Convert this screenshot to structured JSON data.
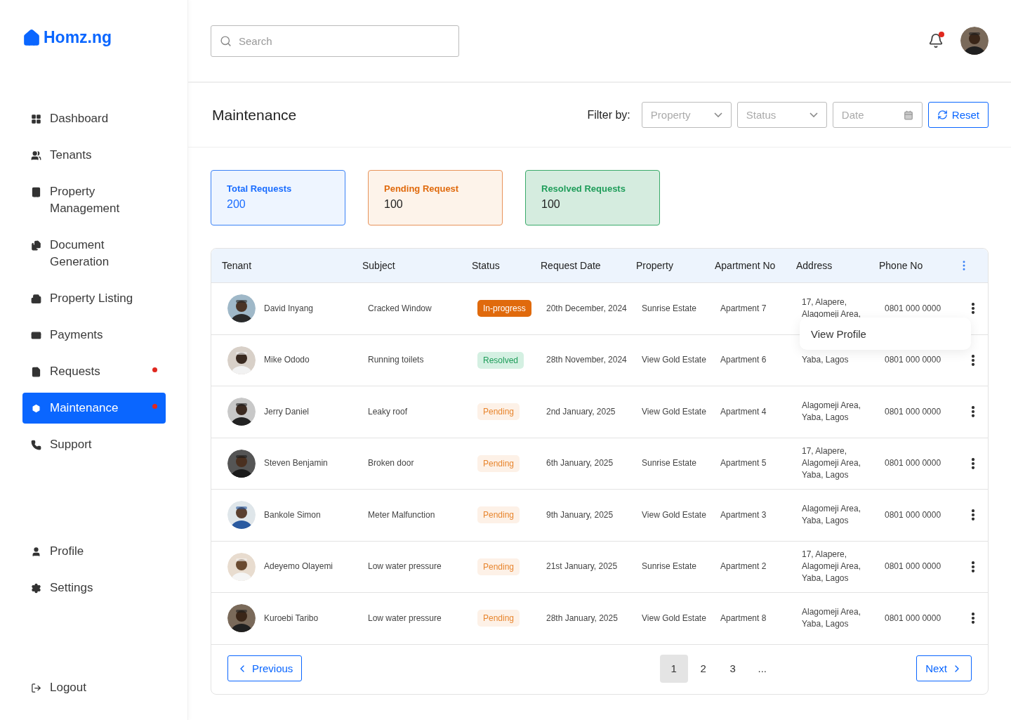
{
  "brand": {
    "name": "Homz.ng"
  },
  "sidebar": {
    "items": [
      {
        "label": "Dashboard",
        "selected": false,
        "dot": false
      },
      {
        "label": "Tenants",
        "selected": false,
        "dot": false
      },
      {
        "label": "Property Management",
        "selected": false,
        "dot": false
      },
      {
        "label": "Document Generation",
        "selected": false,
        "dot": false
      },
      {
        "label": "Property Listing",
        "selected": false,
        "dot": false
      },
      {
        "label": "Payments",
        "selected": false,
        "dot": false
      },
      {
        "label": "Requests",
        "selected": false,
        "dot": true
      },
      {
        "label": "Maintenance",
        "selected": true,
        "dot": true
      },
      {
        "label": "Support",
        "selected": false,
        "dot": false
      }
    ],
    "bottom_items": [
      {
        "label": "Profile"
      },
      {
        "label": "Settings"
      }
    ],
    "logout": "Logout"
  },
  "topbar": {
    "search": {
      "placeholder": "Search"
    },
    "notification_dot": true
  },
  "page": {
    "title": "Maintenance",
    "filter_label": "Filter by:",
    "filters": [
      {
        "kind": "select",
        "placeholder": "Property"
      },
      {
        "kind": "select",
        "placeholder": "Status"
      },
      {
        "kind": "date",
        "placeholder": "Date"
      }
    ],
    "reset": "Reset"
  },
  "cards": [
    {
      "kind": "total",
      "label": "Total Requests",
      "value": "200"
    },
    {
      "kind": "pending",
      "label": "Pending Request",
      "value": "100"
    },
    {
      "kind": "resolved",
      "label": "Resolved Requests",
      "value": "100"
    }
  ],
  "table": {
    "columns": [
      "Tenant",
      "Subject",
      "Status",
      "Request Date",
      "Property",
      "Apartment No",
      "Address",
      "Phone No"
    ],
    "rows": [
      {
        "tenant": "David Inyang",
        "subject": "Cracked Window",
        "status": {
          "kind": "in_progress",
          "label": "In-progress"
        },
        "date": "20th December, 2024",
        "property": "Sunrise Estate",
        "apartment": "Apartment 7",
        "address": [
          "17, Alapere,",
          "Alagomeji Area,"
        ],
        "phone": "0801 000 0000"
      },
      {
        "tenant": "Mike Ododo",
        "subject": "Running toilets",
        "status": {
          "kind": "resolved",
          "label": "Resolved"
        },
        "date": "28th November, 2024",
        "property": "View Gold Estate",
        "apartment": "Apartment 6",
        "address": [
          "Yaba, Lagos"
        ],
        "phone": "0801 000 0000"
      },
      {
        "tenant": "Jerry Daniel",
        "subject": "Leaky roof",
        "status": {
          "kind": "pending",
          "label": "Pending"
        },
        "date": "2nd January, 2025",
        "property": "View Gold Estate",
        "apartment": "Apartment 4",
        "address": [
          "Alagomeji Area,",
          "Yaba, Lagos"
        ],
        "phone": "0801 000 0000"
      },
      {
        "tenant": "Steven Benjamin",
        "subject": "Broken door",
        "status": {
          "kind": "pending",
          "label": "Pending"
        },
        "date": "6th January, 2025",
        "property": "Sunrise Estate",
        "apartment": "Apartment 5",
        "address": [
          "17, Alapere,",
          "Alagomeji Area,",
          "Yaba, Lagos"
        ],
        "phone": "0801 000 0000"
      },
      {
        "tenant": "Bankole Simon",
        "subject": "Meter Malfunction",
        "status": {
          "kind": "pending",
          "label": "Pending"
        },
        "date": "9th January, 2025",
        "property": "View Gold Estate",
        "apartment": "Apartment 3",
        "address": [
          "Alagomeji Area,",
          "Yaba, Lagos"
        ],
        "phone": "0801 000 0000"
      },
      {
        "tenant": "Adeyemo Olayemi",
        "subject": "Low water pressure",
        "status": {
          "kind": "pending",
          "label": "Pending"
        },
        "date": "21st January, 2025",
        "property": "Sunrise Estate",
        "apartment": "Apartment 2",
        "address": [
          "17, Alapere,",
          "Alagomeji Area,",
          "Yaba, Lagos"
        ],
        "phone": "0801 000 0000"
      },
      {
        "tenant": "Kuroebi Taribo",
        "subject": "Low water pressure",
        "status": {
          "kind": "pending",
          "label": "Pending"
        },
        "date": "28th January, 2025",
        "property": "View Gold Estate",
        "apartment": "Apartment 8",
        "address": [
          "Alagomeji Area,",
          "Yaba, Lagos"
        ],
        "phone": "0801 000 0000"
      }
    ],
    "row_menu": {
      "items": [
        "View Profile"
      ]
    }
  },
  "pagination": {
    "previous": "Previous",
    "next": "Next",
    "pages": [
      {
        "label": "1",
        "selected": true
      },
      {
        "label": "2",
        "selected": false
      },
      {
        "label": "3",
        "selected": false
      },
      {
        "label": "...",
        "selected": false
      }
    ]
  }
}
